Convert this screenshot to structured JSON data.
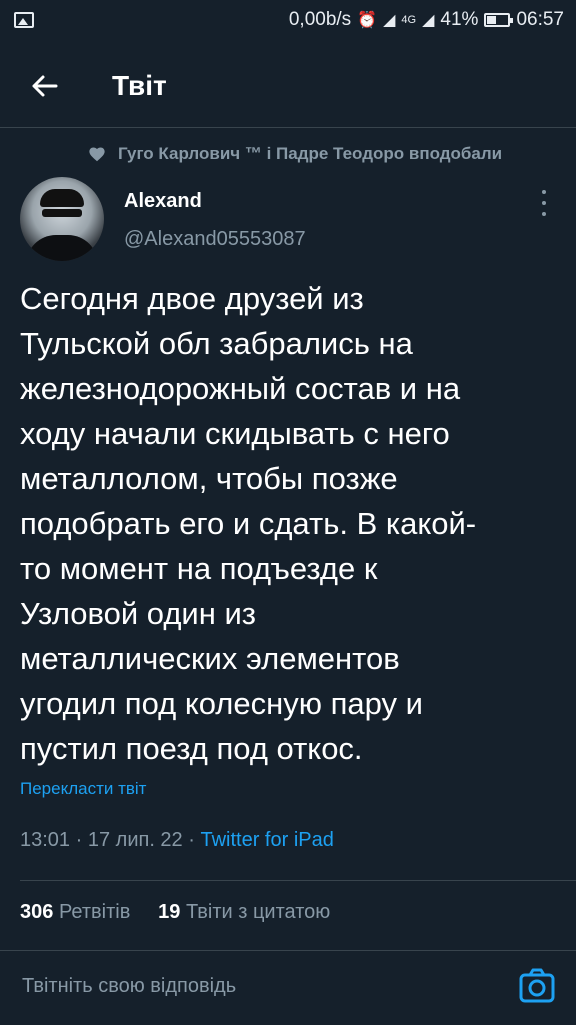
{
  "status_bar": {
    "speed": "0,00b/s",
    "alarm_glyph": "⏰",
    "signal1_glyph": "◢",
    "network": "4G",
    "signal2_glyph": "◢",
    "battery_percent": "41%",
    "battery_level": 0.41,
    "time": "06:57",
    "icons": [
      "gallery-icon",
      "alarm-icon",
      "signal-icon",
      "battery-icon"
    ]
  },
  "header": {
    "title": "Твіт",
    "back_icon": "arrow-left-icon"
  },
  "social_context": {
    "text": "Гуго Карлович ™ і Падре Теодоро вподобали",
    "icon": "heart-icon"
  },
  "tweet": {
    "display_name": "Alexand",
    "handle": "@Alexand05553087",
    "text": "Сегодня двое друзей из\nТульской обл забрались на\nжелезнодорожный состав и на\nходу начали скидывать с него\nметаллолом, чтобы позже\nподобрать его и сдать. В какой-\nто момент на подъезде к\nУзловой один из\nметаллических элементов\nугодил под колесную пару и\nпустил поезд под откос.",
    "translate_label": "Перекласти твіт",
    "meta_time": "13:01",
    "meta_sep1": " · ",
    "meta_date": "17 лип. 22",
    "meta_sep2": " · ",
    "meta_source": "Twitter for iPad"
  },
  "stats": {
    "retweets_count": "306",
    "retweets_label": "Ретвітів",
    "quotes_count": "19",
    "quotes_label": "Твіти з цитатою"
  },
  "reply": {
    "placeholder": "Твітніть свою відповідь",
    "icon": "camera-icon"
  },
  "colors": {
    "background": "#15202b",
    "accent": "#1da1f2",
    "secondary_text": "#8899a6",
    "divider": "#38444d"
  }
}
